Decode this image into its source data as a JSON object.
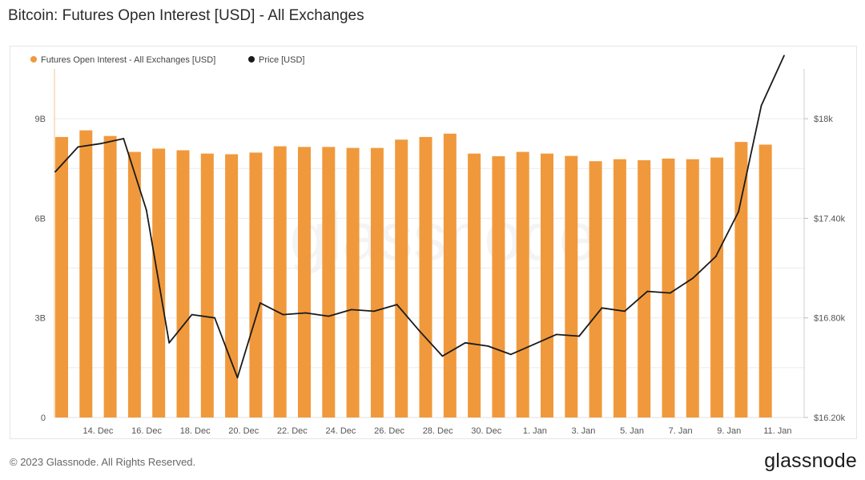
{
  "title": "Bitcoin: Futures Open Interest [USD] - All Exchanges",
  "footer": {
    "copyright": "© 2023 Glassnode. All Rights Reserved.",
    "logo": "glassnode"
  },
  "watermark": "glassnode",
  "colors": {
    "bar": "#F0993C",
    "price_line": "#1a1a1a",
    "grid": "#ebebeb",
    "axis_text": "#555555"
  },
  "chart_data": {
    "type": "bar",
    "legend_position": "top-left",
    "grid": true,
    "x_tick_labels": [
      "14. Dec",
      "16. Dec",
      "18. Dec",
      "20. Dec",
      "22. Dec",
      "24. Dec",
      "26. Dec",
      "28. Dec",
      "30. Dec",
      "1. Jan",
      "3. Jan",
      "5. Jan",
      "7. Jan",
      "9. Jan",
      "11. Jan"
    ],
    "x_tick_positions": [
      1.5,
      3.5,
      5.5,
      7.5,
      9.5,
      11.5,
      13.5,
      15.5,
      17.5,
      19.5,
      21.5,
      23.5,
      25.5,
      27.5,
      29.5
    ],
    "left_axis": {
      "ylim": [
        0,
        10.5
      ],
      "ticks": [
        0,
        3,
        6,
        9
      ],
      "tick_labels": [
        "0",
        "3B",
        "6B",
        "9B"
      ]
    },
    "right_axis": {
      "ylim": [
        16200,
        18300
      ],
      "ticks": [
        16200,
        16800,
        17400,
        18000
      ],
      "tick_labels": [
        "$16.20k",
        "$16.80k",
        "$17.40k",
        "$18k"
      ]
    },
    "series": [
      {
        "name": "Futures Open Interest - All Exchanges [USD]",
        "type": "bar",
        "axis": "left",
        "unit": "billion USD",
        "values": [
          8.45,
          8.65,
          8.48,
          8.0,
          8.1,
          8.05,
          7.95,
          7.93,
          7.98,
          8.17,
          8.15,
          8.15,
          8.12,
          8.12,
          8.37,
          8.45,
          8.55,
          7.95,
          7.87,
          8.0,
          7.95,
          7.88,
          7.72,
          7.78,
          7.75,
          7.8,
          7.78,
          7.83,
          8.3,
          8.22
        ]
      },
      {
        "name": "Price [USD]",
        "type": "line",
        "axis": "right",
        "values": [
          17680,
          17830,
          17850,
          17880,
          17450,
          16650,
          16820,
          16800,
          16440,
          16890,
          16820,
          16830,
          16810,
          16850,
          16840,
          16880,
          16720,
          16570,
          16650,
          16630,
          16580,
          16640,
          16700,
          16690,
          16860,
          16840,
          16960,
          16950,
          17040,
          17170,
          17440,
          18080,
          18380
        ]
      }
    ]
  }
}
